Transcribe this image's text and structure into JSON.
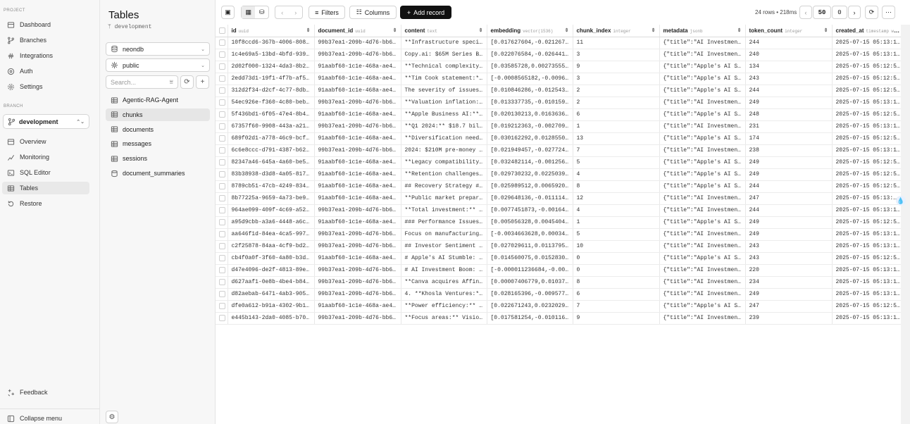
{
  "sidebar": {
    "project_label": "PROJECT",
    "project_items": [
      {
        "label": "Dashboard",
        "icon": "dashboard-icon"
      },
      {
        "label": "Branches",
        "icon": "branch-icon"
      },
      {
        "label": "Integrations",
        "icon": "integrations-icon"
      },
      {
        "label": "Auth",
        "icon": "auth-icon"
      },
      {
        "label": "Settings",
        "icon": "gear-icon"
      }
    ],
    "branch_label": "BRANCH",
    "branch_value": "development",
    "branch_items": [
      {
        "label": "Overview",
        "icon": "overview-icon"
      },
      {
        "label": "Monitoring",
        "icon": "monitoring-icon"
      },
      {
        "label": "SQL Editor",
        "icon": "sql-editor-icon"
      },
      {
        "label": "Tables",
        "icon": "table-icon"
      },
      {
        "label": "Restore",
        "icon": "restore-icon"
      }
    ],
    "feedback": "Feedback",
    "collapse": "Collapse menu"
  },
  "panel": {
    "title": "Tables",
    "branch": "development",
    "database": "neondb",
    "schema": "public",
    "search_placeholder": "Search...",
    "tables": [
      "Agentic-RAG-Agent",
      "chunks",
      "documents",
      "messages",
      "sessions",
      "document_summaries"
    ]
  },
  "toolbar": {
    "filters": "Filters",
    "columns": "Columns",
    "add_record": "Add record",
    "row_info": "24 rows • 218ms",
    "limit": "50",
    "offset": "0"
  },
  "table": {
    "columns": [
      {
        "name": "id",
        "type": "uuid"
      },
      {
        "name": "document_id",
        "type": "uuid"
      },
      {
        "name": "content",
        "type": "text"
      },
      {
        "name": "embedding",
        "type": "vector(1536)"
      },
      {
        "name": "chunk_index",
        "type": "integer"
      },
      {
        "name": "metadata",
        "type": "jsonb"
      },
      {
        "name": "token_count",
        "type": "integer"
      },
      {
        "name": "created_at",
        "type": "timestamp wi..."
      }
    ],
    "rows": [
      [
        "10f8ccd6-367b-4006-808…",
        "99b37ea1-209b-4d76-bb6…",
        "**Infrastructure speci…",
        "[0.017627604,-0.021267…",
        "11",
        "{\"title\":\"AI Investmen…",
        "244",
        "2025-07-15 05:13:17.…"
      ],
      [
        "1c4e69a5-13bd-4bfd-939…",
        "99b37ea1-209b-4d76-bb6…",
        "Copy.ai: $65M Series B…",
        "[0.022076584,-0.026441…",
        "3",
        "{\"title\":\"AI Investmen…",
        "240",
        "2025-07-15 05:13:17.…"
      ],
      [
        "2d02f000-1324-4da3-8b2…",
        "91aabf60-1c1e-468a-ae4…",
        "**Technical complexity…",
        "[0.03585728,0.00273555…",
        "9",
        "{\"title\":\"Apple's AI S…",
        "134",
        "2025-07-15 05:12:53.…"
      ],
      [
        "2edd73d1-19f1-4f7b-af5…",
        "91aabf60-1c1e-468a-ae4…",
        "**Tim Cook statement:*…",
        "[-0.0008565182,-0.0096…",
        "3",
        "{\"title\":\"Apple's AI S…",
        "243",
        "2025-07-15 05:12:53.…"
      ],
      [
        "312d2f34-d2cf-4c77-8db…",
        "91aabf60-1c1e-468a-ae4…",
        "The severity of issues…",
        "[0.010846286,-0.012543…",
        "2",
        "{\"title\":\"Apple's AI S…",
        "244",
        "2025-07-15 05:12:53.…"
      ],
      [
        "54ec926e-f360-4c80-beb…",
        "99b37ea1-209b-4d76-bb6…",
        "**Valuation inflation:…",
        "[0.013337735,-0.010159…",
        "2",
        "{\"title\":\"AI Investmen…",
        "249",
        "2025-07-15 05:13:17.…"
      ],
      [
        "5f436bd1-6f05-47e4-8b4…",
        "91aabf60-1c1e-468a-ae4…",
        "**Apple Business AI:**…",
        "[0.020130213,0.0163636…",
        "6",
        "{\"title\":\"Apple's AI S…",
        "248",
        "2025-07-15 05:12:53.…"
      ],
      [
        "67357f60-9908-443a-a21…",
        "99b37ea1-209b-4d76-bb6…",
        "**Q1 2024:** $18.7 bil…",
        "[0.019212363,-0.002709…",
        "1",
        "{\"title\":\"AI Investmen…",
        "231",
        "2025-07-15 05:13:17.…"
      ],
      [
        "689f02d1-a778-46c9-bcf…",
        "91aabf60-1c1e-468a-ae4…",
        "**Diversification need…",
        "[0.030162292,0.0128550…",
        "13",
        "{\"title\":\"Apple's AI S…",
        "174",
        "2025-07-15 05:12:53.…"
      ],
      [
        "6c6e8ccc-d791-4387-b62…",
        "99b37ea1-209b-4d76-bb6…",
        "2024: $210M pre-money …",
        "[0.021949457,-0.027724…",
        "7",
        "{\"title\":\"AI Investmen…",
        "238",
        "2025-07-15 05:13:17.…"
      ],
      [
        "82347a46-645a-4a60-be5…",
        "91aabf60-1c1e-468a-ae4…",
        "**Legacy compatibility…",
        "[0.032482114,-0.001256…",
        "5",
        "{\"title\":\"Apple's AI S…",
        "249",
        "2025-07-15 05:12:53.…"
      ],
      [
        "83b38938-d3d8-4a05-817…",
        "91aabf60-1c1e-468a-ae4…",
        "**Retention challenges…",
        "[0.029730232,0.0225039…",
        "4",
        "{\"title\":\"Apple's AI S…",
        "249",
        "2025-07-15 05:12:53.…"
      ],
      [
        "8789cb51-47cb-4249-834…",
        "91aabf60-1c1e-468a-ae4…",
        "## Recovery Strategy #…",
        "[0.025989512,0.0065920…",
        "8",
        "{\"title\":\"Apple's AI S…",
        "244",
        "2025-07-15 05:12:53.…"
      ],
      [
        "8b77225a-9659-4a73-be9…",
        "91aabf60-1c1e-468a-ae4…",
        "**Public market prepar…",
        "[0.029648136,-0.011114…",
        "12",
        "{\"title\":\"AI Investmen…",
        "247",
        "2025-07-15 05:13:…"
      ],
      [
        "964ae099-409f-4c69-a52…",
        "99b37ea1-209b-4d76-bb6…",
        "**Total investment:** …",
        "[0.0077451873,-0.00164…",
        "4",
        "{\"title\":\"AI Investmen…",
        "244",
        "2025-07-15 05:13:17.…"
      ],
      [
        "a95d9cbb-a3a6-4448-a6c…",
        "91aabf60-1c1e-468a-ae4…",
        "### Performance Issues…",
        "[0.005056328,0.0045404…",
        "1",
        "{\"title\":\"Apple's AI S…",
        "249",
        "2025-07-15 05:12:53.…"
      ],
      [
        "aa646f1d-84ea-4ca5-997…",
        "99b37ea1-209b-4d76-bb6…",
        "Focus on manufacturing…",
        "[-0.0034663628,0.00034…",
        "5",
        "{\"title\":\"AI Investmen…",
        "249",
        "2025-07-15 05:13:17.…"
      ],
      [
        "c2f25878-84aa-4cf9-bd2…",
        "99b37ea1-209b-4d76-bb6…",
        "## Investor Sentiment …",
        "[0.027029611,0.0113795…",
        "10",
        "{\"title\":\"AI Investmen…",
        "243",
        "2025-07-15 05:13:17.…"
      ],
      [
        "cb4f0a0f-3f60-4a80-b3d…",
        "91aabf60-1c1e-468a-ae4…",
        "# Apple's AI Stumble: …",
        "[0.014560075,0.0152830…",
        "0",
        "{\"title\":\"Apple's AI S…",
        "243",
        "2025-07-15 05:12:53.…"
      ],
      [
        "d47e4096-de2f-4813-89e…",
        "99b37ea1-209b-4d76-bb6…",
        "# AI Investment Boom: …",
        "[-0.000011236684,-0.00…",
        "0",
        "{\"title\":\"AI Investmen…",
        "220",
        "2025-07-15 05:13:17.…"
      ],
      [
        "d627aaf1-0e8b-4be4-b84…",
        "99b37ea1-209b-4d76-bb6…",
        "**Canva acquires Affin…",
        "[0.00007406779,0.01037…",
        "8",
        "{\"title\":\"AI Investmen…",
        "234",
        "2025-07-15 05:13:17.…"
      ],
      [
        "d82aebab-6471-4ab3-905…",
        "99b37ea1-209b-4d76-bb6…",
        "4. **Khosla Ventures:*…",
        "[0.028165396,-0.009577…",
        "6",
        "{\"title\":\"AI Investmen…",
        "249",
        "2025-07-15 05:13:17.…"
      ],
      [
        "dfe0a612-b91a-4302-9b1…",
        "91aabf60-1c1e-468a-ae4…",
        "**Power efficiency:** …",
        "[0.022671243,0.0232029…",
        "7",
        "{\"title\":\"Apple's AI S…",
        "247",
        "2025-07-15 05:12:53.…"
      ],
      [
        "e445b143-2da0-4085-b70…",
        "99b37ea1-209b-4d76-bb6…",
        "**Focus areas:** Visio…",
        "[0.017581254,-0.010116…",
        "9",
        "{\"title\":\"AI Investmen…",
        "239",
        "2025-07-15 05:13:17.…"
      ]
    ]
  }
}
